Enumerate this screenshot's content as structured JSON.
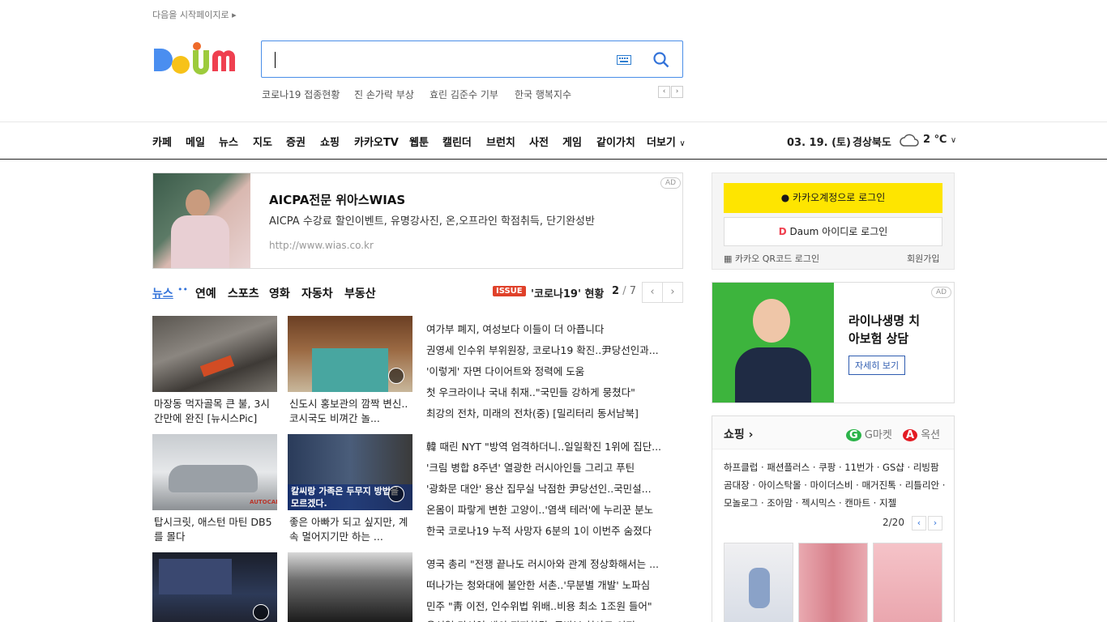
{
  "top": {
    "start_page": "다음을 시작페이지로"
  },
  "search": {
    "trending": [
      "코로나19 접종현황",
      "진 손가락 부상",
      "효린 김준수 기부",
      "한국 행복지수"
    ]
  },
  "nav": {
    "items": [
      "카페",
      "메일",
      "뉴스",
      "지도",
      "증권",
      "쇼핑",
      "카카오TV",
      "웹툰",
      "캘린더",
      "브런치",
      "사전",
      "게임",
      "같이가치",
      "더보기"
    ],
    "date": "03. 19. (토)",
    "region": "경상북도",
    "temp": "2 ℃"
  },
  "ad1": {
    "title": "AICPA전문 위아스WIAS",
    "desc": "AICPA 수강료 할인이벤트, 유명강사진, 온,오프라인 학점취득, 단기완성반",
    "url": "http://www.wias.co.kr",
    "tag": "AD"
  },
  "news": {
    "tabs": [
      "뉴스",
      "연예",
      "스포츠",
      "영화",
      "자동차",
      "부동산"
    ],
    "issue_badge": "ISSUE",
    "issue_text": "'코로나19' 현황",
    "page_current": "2",
    "page_sep": "/",
    "page_total": "7",
    "thumbs": [
      {
        "caption": "마장동 먹자골목 큰 불, 3시간만에 완진 [뉴시스Pic]"
      },
      {
        "caption": "신도시 홍보관의 깜짝 변신..코시국도 비껴간 놀..."
      },
      {
        "caption": "탑시크릿, 애스턴 마틴 DB5를 몰다"
      },
      {
        "caption": "좋은 아빠가 되고 싶지만, 계속 멀어지기만 하는 ..."
      }
    ],
    "thumb_overlay": "칼씨랑 가족은 두무지 방법을 모르겠다.",
    "autocar": "AUTOCAR",
    "headlines": [
      "여가부 폐지, 여성보다 이들이 더 아픕니다",
      "권영세 인수위 부위원장, 코로나19 확진..尹당선인과...",
      "'이렇게' 자면 다이어트와 정력에 도움",
      "첫 우크라이나 국내 취재..\"국민들 강하게 뭉쳤다\"",
      "최강의 전차, 미래의 전차(중) [밀리터리 동서남북]",
      "韓 때린 NYT \"방역 엄격하더니..일일확진 1위에 집단...",
      "'크림 병합 8주년' 열광한 러시아인들 그리고 푸틴",
      "'광화문 대안' 용산 집무실 낙점한 尹당선인..국민설...",
      "온몸이 파랗게 변한 고양이..'염색 테러'에 누리꾼 분노",
      "한국 코로나19 누적 사망자 6분의 1이 이번주 숨졌다",
      "영국 총리 \"전쟁 끝나도 러시아와 관계 정상화해서는 ...",
      "떠나가는 청와대에 불안한 서촌..'무분별 개발' 노파심",
      "민주 \"靑 이전, 인수위법 위배..비용 최소 1조원 들어\"",
      "윤석열 당선인 새의 진지한결, 국방부 청사로 이전"
    ]
  },
  "login": {
    "kakao": "카카오계정으로 로그인",
    "daum": "Daum 아이디로 로그인",
    "qr": "카카오 QR코드 로그인",
    "join": "회원가입"
  },
  "ad2": {
    "title_line1": "라이나생명 치",
    "title_line2": "아보험 상담",
    "button": "자세히 보기",
    "tag": "AD"
  },
  "shopping": {
    "title": "쇼핑",
    "gmarket": "G마켓",
    "auction": "옥션",
    "links": "하프클럽 · 패션플러스 · 쿠팡 · 11번가 · GS샵 · 리빙팜곰대장 · 아이스탁몰 · 마이더스비 · 매거진톡 · 리틀리안 · 모놀로그 · 조아맘 · 젝시믹스 · 캔마트 · 지젤",
    "page": "2/20"
  },
  "colors": {
    "accent": "#3373d9",
    "kakao": "#fee500",
    "issue": "#e0412a"
  }
}
